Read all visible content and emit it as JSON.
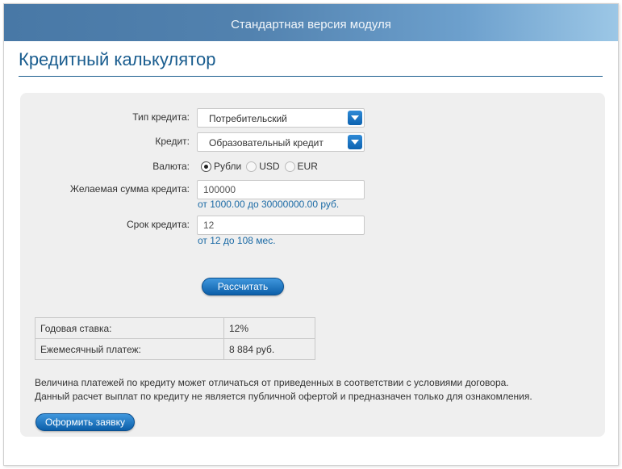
{
  "header": {
    "title": "Стандартная версия модуля"
  },
  "page": {
    "title": "Кредитный калькулятор"
  },
  "form": {
    "credit_type": {
      "label": "Тип кредита:",
      "value": "Потребительский"
    },
    "credit": {
      "label": "Кредит:",
      "value": "Образовательный кредит"
    },
    "currency": {
      "label": "Валюта:",
      "options": [
        "Рубли",
        "USD",
        "EUR"
      ],
      "selected": "Рубли"
    },
    "amount": {
      "label": "Желаемая сумма кредита:",
      "value": "100000",
      "hint": "от 1000.00 до 30000000.00 руб."
    },
    "term": {
      "label": "Срок кредита:",
      "value": "12",
      "hint": "от 12 до 108 мес."
    },
    "calculate_label": "Рассчитать"
  },
  "results": {
    "rows": [
      {
        "label": "Годовая ставка:",
        "value": "12%"
      },
      {
        "label": "Ежемесячный платеж:",
        "value": "8 884 руб."
      }
    ]
  },
  "disclaimer": {
    "line1": "Величина платежей по кредиту может отличаться от приведенных в соответствии с условиями договора.",
    "line2": "Данный расчет выплат по кредиту не является публичной офертой и предназначен только для ознакомления."
  },
  "apply_label": "Оформить заявку",
  "colors": {
    "accent": "#1a5d8f",
    "button": "#0c5fa9",
    "hint": "#1b6aa5"
  }
}
